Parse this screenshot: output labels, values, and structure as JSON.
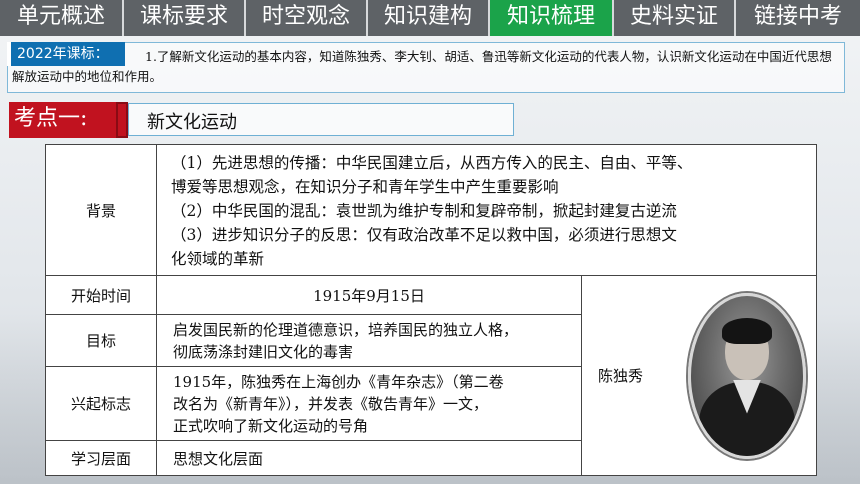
{
  "nav": {
    "tabs": [
      {
        "label": "单元概述",
        "active": false
      },
      {
        "label": "课标要求",
        "active": false
      },
      {
        "label": "时空观念",
        "active": false
      },
      {
        "label": "知识建构",
        "active": false
      },
      {
        "label": "知识梳理",
        "active": true
      },
      {
        "label": "史料实证",
        "active": false
      },
      {
        "label": "链接中考",
        "active": false
      }
    ]
  },
  "standard": {
    "tag": "2022年课标：",
    "text": "1.了解新文化运动的基本内容，知道陈独秀、李大钊、胡适、鲁迅等新文化运动的代表人物，认识新文化运动在中国近代思想解放运动中的地位和作用。"
  },
  "keypoint": {
    "label": "考点一:",
    "title": "新文化运动"
  },
  "table": {
    "background": {
      "label": "背景",
      "lines": [
        "（1）先进思想的传播：中华民国建立后，从西方传入的民主、自由、平等、",
        "博爱等思想观念，在知识分子和青年学生中产生重要影响",
        "（2）中华民国的混乱：袁世凯为维护专制和复辟帝制，掀起封建复古逆流",
        "（3）进步知识分子的反思：仅有政治改革不足以救中国，必须进行思想文",
        "化领域的革新"
      ]
    },
    "start": {
      "label": "开始时间",
      "value": "1915年9月15日"
    },
    "goal": {
      "label": "目标",
      "lines": [
        "启发国民新的伦理道德意识，培养国民的独立人格，",
        "彻底荡涤封建旧文化的毒害"
      ]
    },
    "rise": {
      "label": "兴起标志",
      "lines": [
        "1915年，陈独秀在上海创办《青年杂志》（第二卷",
        "改名为《新青年》），并发表《敬告青年》一文，",
        "正式吹响了新文化运动的号角"
      ]
    },
    "level": {
      "label": "学习层面",
      "value": "思想文化层面"
    },
    "person": {
      "name": "陈独秀"
    }
  }
}
